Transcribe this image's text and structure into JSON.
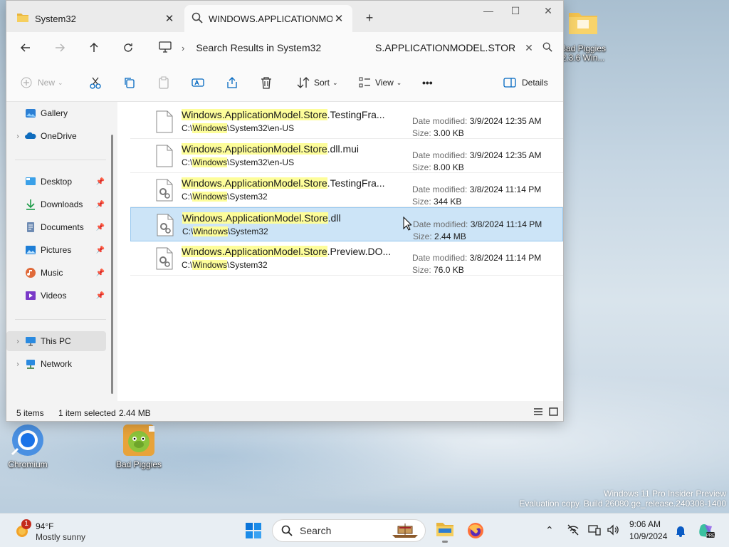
{
  "tabs": [
    {
      "label": "System32",
      "active": false
    },
    {
      "label": "WINDOWS.APPLICATIONMODEL.STORE",
      "active": true
    }
  ],
  "window_controls": {
    "minimize": "—",
    "maximize": "☐",
    "close": "✕"
  },
  "address": {
    "path": "Search Results in System32"
  },
  "search": {
    "value": "S.APPLICATIONMODEL.STOR"
  },
  "toolbar": {
    "new_label": "New",
    "sort_label": "Sort",
    "view_label": "View",
    "more_label": "•••",
    "details_label": "Details"
  },
  "sidebar": {
    "items": [
      {
        "label": "Gallery"
      },
      {
        "label": "OneDrive"
      },
      {
        "label": "Desktop"
      },
      {
        "label": "Downloads"
      },
      {
        "label": "Documents"
      },
      {
        "label": "Pictures"
      },
      {
        "label": "Music"
      },
      {
        "label": "Videos"
      },
      {
        "label": "This PC"
      },
      {
        "label": "Network"
      }
    ]
  },
  "files": {
    "date_key": "Date modified:",
    "size_key": "Size:",
    "items": [
      {
        "hl": "Windows.ApplicationModel.Store",
        "rest": ".TestingFra...",
        "p1": "C:\\",
        "p2": "Windows",
        "p3": "\\System32\\en-US",
        "date": "3/9/2024 12:35 AM",
        "size": "3.00 KB"
      },
      {
        "hl": "Windows.ApplicationModel.Store",
        "rest": ".dll.mui",
        "p1": "C:\\",
        "p2": "Windows",
        "p3": "\\System32\\en-US",
        "date": "3/9/2024 12:35 AM",
        "size": "8.00 KB"
      },
      {
        "hl": "Windows.ApplicationModel.Store",
        "rest": ".TestingFra...",
        "p1": "C:\\",
        "p2": "Windows",
        "p3": "\\System32",
        "date": "3/8/2024 11:14 PM",
        "size": "344 KB"
      },
      {
        "hl": "Windows.ApplicationModel.Store",
        "rest": ".dll",
        "p1": "C:\\",
        "p2": "Windows",
        "p3": "\\System32",
        "date": "3/8/2024 11:14 PM",
        "size": "2.44 MB"
      },
      {
        "hl": "Windows.ApplicationModel.Store",
        "rest": ".Preview.DO...",
        "p1": "C:\\",
        "p2": "Windows",
        "p3": "\\System32",
        "date": "3/8/2024 11:14 PM",
        "size": "76.0 KB"
      }
    ]
  },
  "status": {
    "count": "5 items",
    "selection": "1 item selected",
    "size": "2.44 MB"
  },
  "desktop": {
    "chromium": "Chromium",
    "badpiggies": "Bad Piggies",
    "folder_line1": "Bad Piggies",
    "folder_line2": "2.3.6 Win..."
  },
  "watermark": {
    "line1": "Windows 11 Pro Insider Preview",
    "line2": "Evaluation copy. Build 26080.ge_release.240308-1400"
  },
  "taskbar": {
    "weather_temp": "94°F",
    "weather_desc": "Mostly sunny",
    "weather_badge": "1",
    "search_label": "Search",
    "time": "9:06 AM",
    "date": "10/9/2024"
  },
  "colors": {
    "accent": "#0067c0",
    "selection": "#cce4f7",
    "highlight": "#fdfd9a"
  }
}
